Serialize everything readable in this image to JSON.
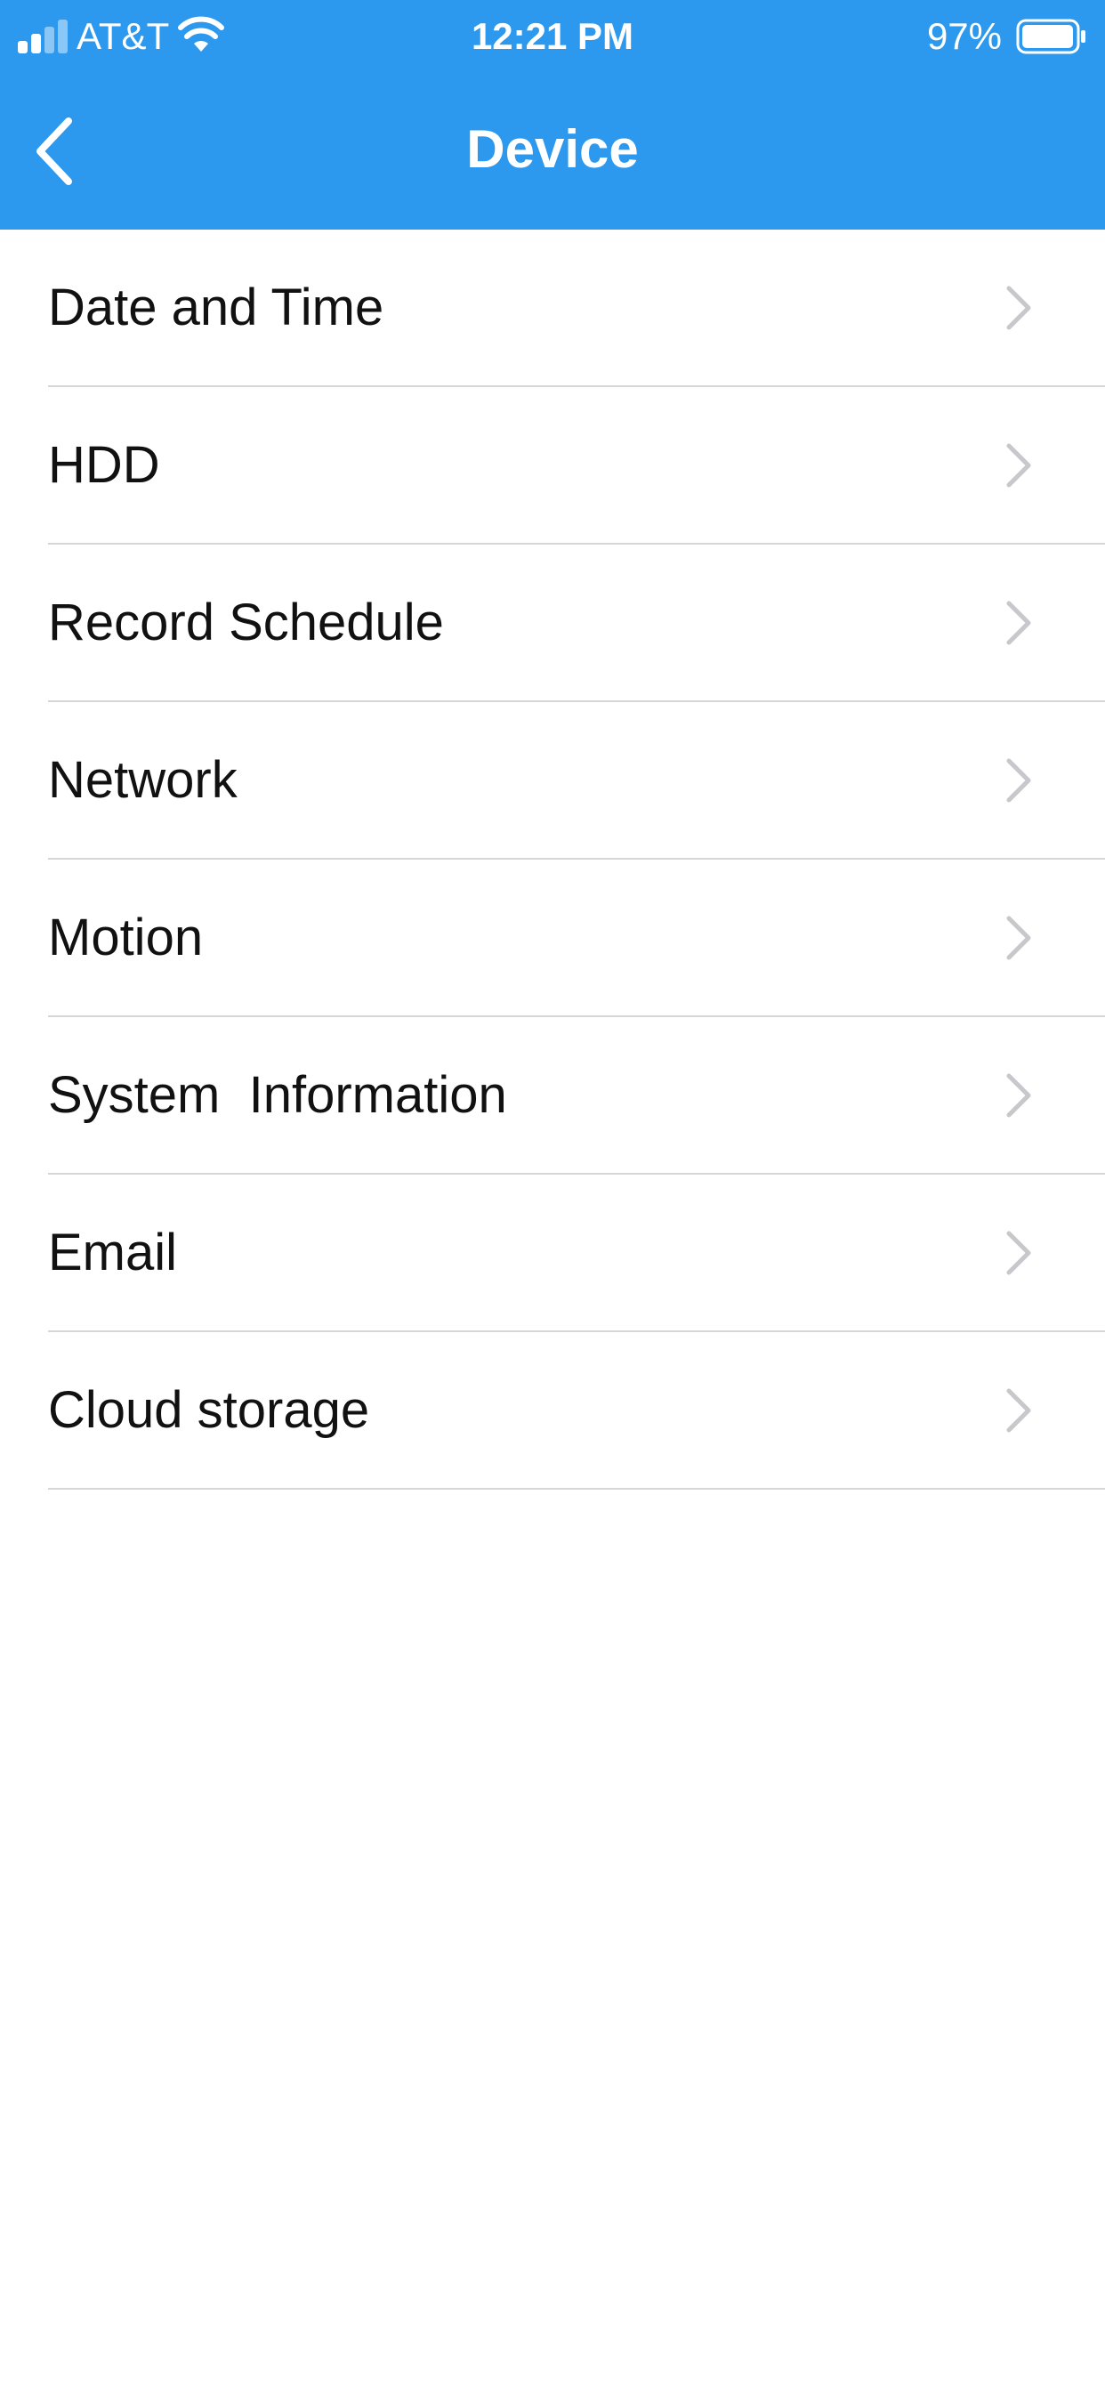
{
  "status_bar": {
    "carrier": "AT&T",
    "time": "12:21 PM",
    "battery_percent": "97%",
    "icons": [
      "signal-icon",
      "wifi-icon",
      "battery-icon"
    ]
  },
  "nav": {
    "title": "Device",
    "back_icon": "chevron-left-icon"
  },
  "menu": {
    "items": [
      {
        "label": "Date and Time"
      },
      {
        "label": "HDD"
      },
      {
        "label": "Record Schedule"
      },
      {
        "label": "Network"
      },
      {
        "label": "Motion"
      },
      {
        "label": "System  Information"
      },
      {
        "label": "Email"
      },
      {
        "label": "Cloud storage"
      }
    ],
    "row_icon": "chevron-right-icon"
  },
  "colors": {
    "header": "#2d99ee",
    "text": "#111111",
    "chevron": "#c7c7cc",
    "divider": "#d6d6d6"
  }
}
